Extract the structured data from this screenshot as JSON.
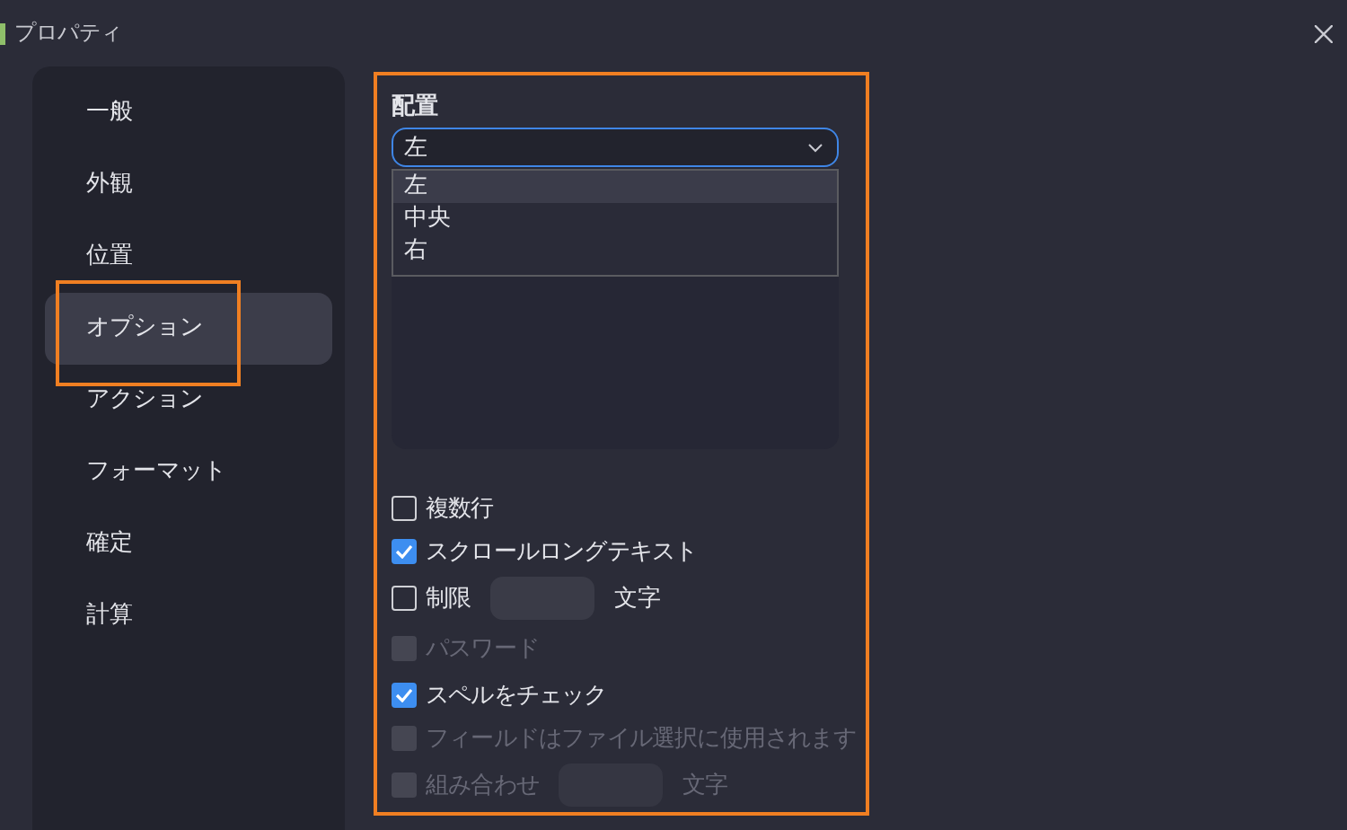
{
  "window": {
    "title": "プロパティ"
  },
  "sidebar": {
    "items": [
      {
        "label": "一般",
        "selected": false
      },
      {
        "label": "外観",
        "selected": false
      },
      {
        "label": "位置",
        "selected": false
      },
      {
        "label": "オプション",
        "selected": true
      },
      {
        "label": "アクション",
        "selected": false
      },
      {
        "label": "フォーマット",
        "selected": false
      },
      {
        "label": "確定",
        "selected": false
      },
      {
        "label": "計算",
        "selected": false
      }
    ]
  },
  "alignment": {
    "label": "配置",
    "value": "左",
    "options": [
      {
        "label": "左",
        "selected": true
      },
      {
        "label": "中央",
        "selected": false
      },
      {
        "label": "右",
        "selected": false
      }
    ]
  },
  "options": [
    {
      "kind": "check",
      "label": "複数行",
      "checked": false,
      "disabled": false
    },
    {
      "kind": "check",
      "label": "スクロールロングテキスト",
      "checked": true,
      "disabled": false
    },
    {
      "kind": "check_field",
      "label": "制限",
      "suffix": "文字",
      "checked": false,
      "disabled": false
    },
    {
      "kind": "check",
      "label": "パスワード",
      "checked": false,
      "disabled": true
    },
    {
      "kind": "check",
      "label": "スペルをチェック",
      "checked": true,
      "disabled": false
    },
    {
      "kind": "check",
      "label": "フィールドはファイル選択に使用されます",
      "checked": false,
      "disabled": true
    },
    {
      "kind": "check_field",
      "label": "組み合わせ",
      "suffix": "文字",
      "checked": false,
      "disabled": true
    }
  ]
}
